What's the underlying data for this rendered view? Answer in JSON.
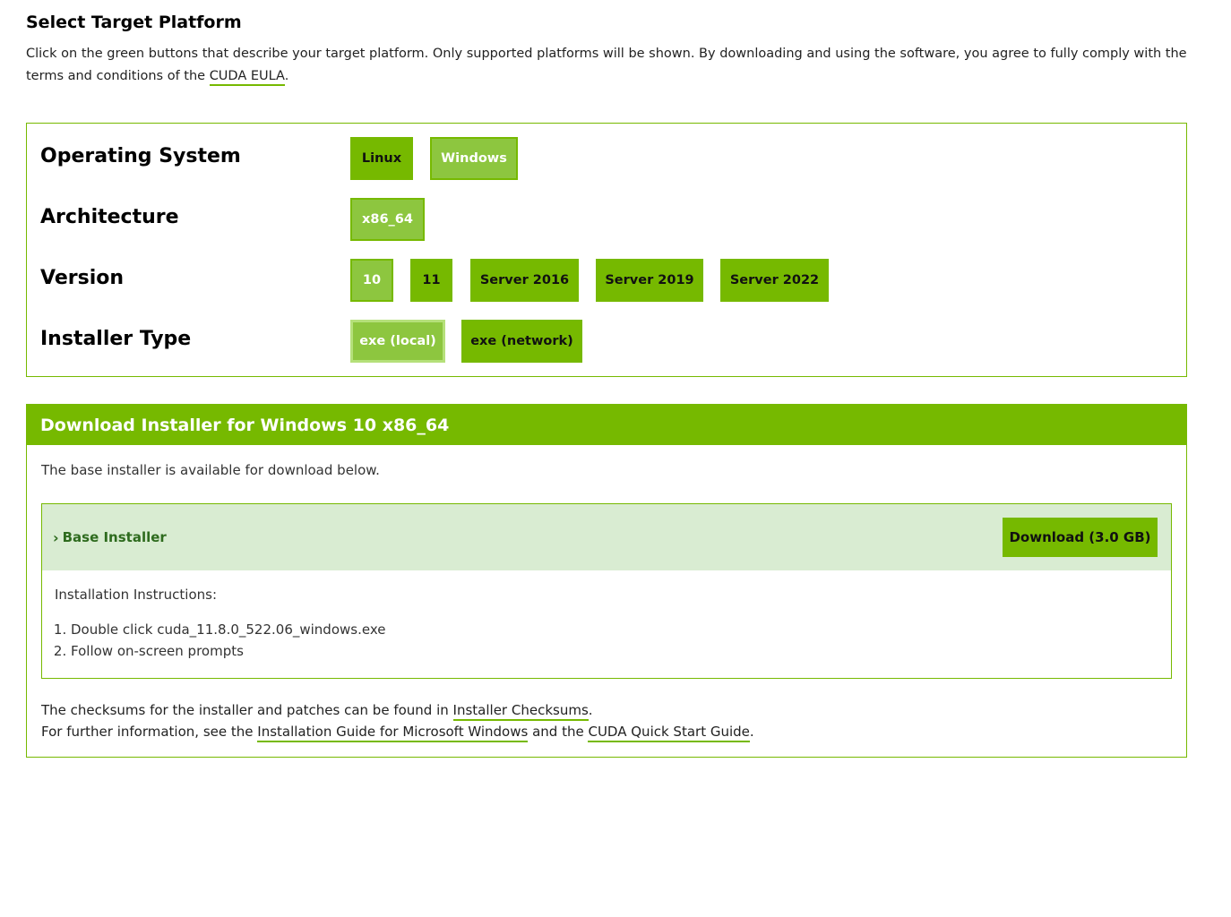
{
  "header": {
    "title": "Select Target Platform",
    "intro_text": "Click on the green buttons that describe your target platform. Only supported platforms will be shown. By downloading and using the software, you agree to fully comply with the terms and conditions of the",
    "eula_link": "CUDA EULA",
    "intro_end": "."
  },
  "selector": {
    "os": {
      "label": "Operating System",
      "options": [
        "Linux",
        "Windows"
      ],
      "selected": "Windows"
    },
    "arch": {
      "label": "Architecture",
      "options": [
        "x86_64"
      ],
      "selected": "x86_64"
    },
    "version": {
      "label": "Version",
      "options": [
        "10",
        "11",
        "Server 2016",
        "Server 2019",
        "Server 2022"
      ],
      "selected": "10"
    },
    "installer": {
      "label": "Installer Type",
      "options": [
        "exe (local)",
        "exe (network)"
      ],
      "selected": "exe (local)"
    }
  },
  "download": {
    "header": "Download Installer for Windows 10 x86_64",
    "subtitle": "The base installer is available for download below.",
    "base": {
      "title": "Base Installer",
      "button": "Download (3.0 GB)",
      "instructions_label": "Installation Instructions:",
      "steps": [
        "Double click cuda_11.8.0_522.06_windows.exe",
        "Follow on-screen prompts"
      ]
    },
    "footer": {
      "line1_pre": "The checksums for the installer and patches can be found in",
      "checksums_link": "Installer Checksums",
      "line1_post": ".",
      "line2_pre": "For further information, see the",
      "guide_link": "Installation Guide for Microsoft Windows",
      "line2_mid": "and the",
      "quickstart_link": "CUDA Quick Start Guide",
      "line2_post": "."
    }
  },
  "colors": {
    "accent": "#76b900",
    "selected": "#8dc63f",
    "installer_header_bg": "#d9ecd2",
    "installer_title": "#2e6b1e"
  }
}
